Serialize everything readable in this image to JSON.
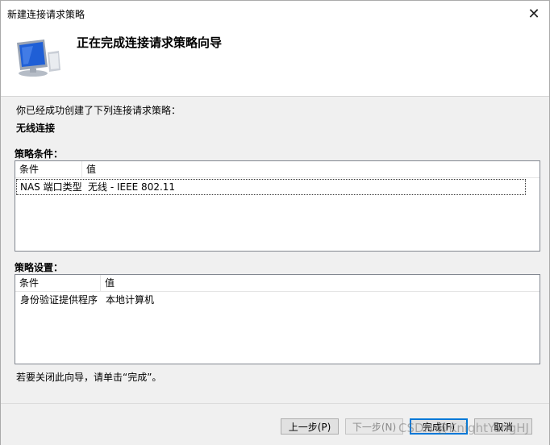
{
  "window": {
    "title": "新建连接请求策略",
    "close_glyph": "✕"
  },
  "header": {
    "title": "正在完成连接请求策略向导"
  },
  "content": {
    "intro": "你已经成功创建了下列连接请求策略：",
    "policy_name": "无线连接",
    "conditions": {
      "label": "策略条件：",
      "columns": [
        "条件",
        "值"
      ],
      "rows": [
        {
          "condition": "NAS 端口类型",
          "value": "无线 - IEEE 802.11"
        }
      ]
    },
    "settings": {
      "label": "策略设置：",
      "columns": [
        "条件",
        "值"
      ],
      "rows": [
        {
          "condition": "身份验证提供程序",
          "value": "本地计算机"
        }
      ]
    },
    "finish_note": "若要关闭此向导，请单击“完成”。"
  },
  "footer": {
    "back_label": "上一步(P)",
    "next_label": "下一步(N)",
    "finish_label": "完成(F)",
    "cancel_label": "取消"
  },
  "watermark": "CSDN @KnightYangHJ",
  "colors": {
    "accent": "#0078d7",
    "icon_screen": "#1f5fd6"
  }
}
